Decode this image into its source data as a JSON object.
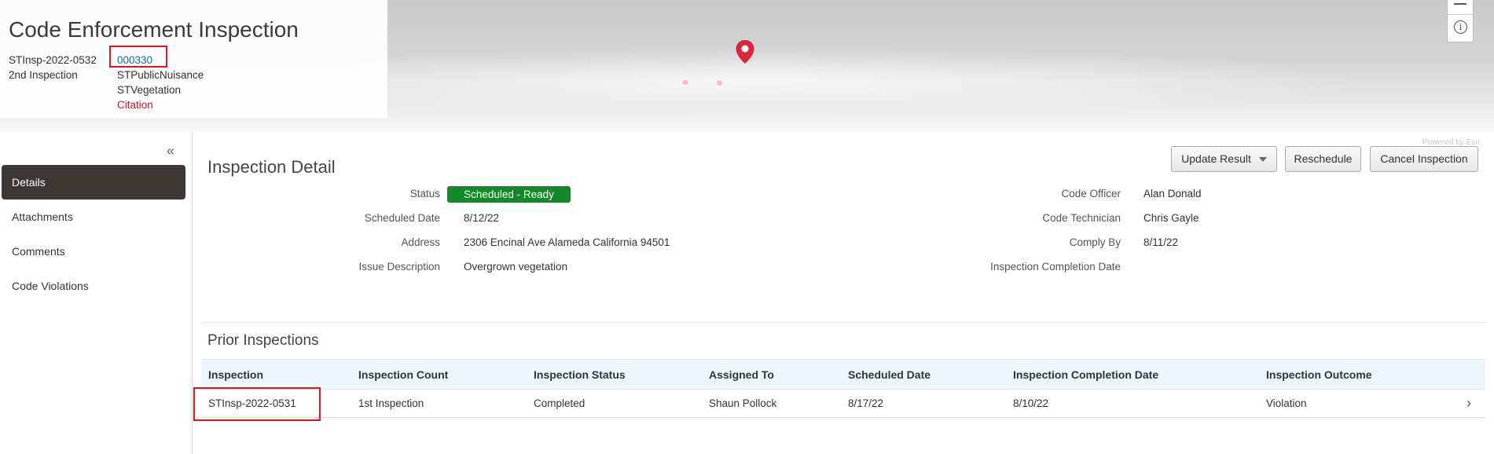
{
  "header": {
    "title": "Code Enforcement Inspection",
    "inspection_id": "STInsp-2022-0532",
    "inspection_count": "2nd Inspection",
    "case_link": "000330",
    "tags": [
      "STPublicNuisance",
      "STVegetation"
    ],
    "citation": "Citation"
  },
  "map": {
    "powered_by": "Powered by Esri",
    "pin_color": "#d8283c",
    "controls": {
      "zoom_out": "—",
      "info": "ⓘ"
    }
  },
  "sidebar": {
    "collapse_icon": "«",
    "items": [
      {
        "label": "Details",
        "active": true
      },
      {
        "label": "Attachments"
      },
      {
        "label": "Comments"
      },
      {
        "label": "Code Violations"
      }
    ]
  },
  "detail": {
    "title": "Inspection Detail",
    "buttons": {
      "update_result": "Update Result",
      "reschedule": "Reschedule",
      "cancel": "Cancel Inspection"
    },
    "status_label": "Status",
    "status_value": "Scheduled - Ready",
    "status_color": "#138a2a",
    "scheduled_date_label": "Scheduled Date",
    "scheduled_date": "8/12/22",
    "address_label": "Address",
    "address": "2306 Encinal Ave Alameda California 94501",
    "issue_label": "Issue Description",
    "issue": "Overgrown vegetation",
    "officer_label": "Code Officer",
    "officer": "Alan Donald",
    "technician_label": "Code Technician",
    "technician": "Chris Gayle",
    "comply_label": "Comply By",
    "comply_by": "8/11/22",
    "completion_label": "Inspection Completion Date",
    "completion_date": ""
  },
  "prior": {
    "title": "Prior Inspections",
    "columns": [
      "Inspection",
      "Inspection Count",
      "Inspection Status",
      "Assigned To",
      "Scheduled Date",
      "Inspection Completion Date",
      "Inspection Outcome"
    ],
    "rows": [
      [
        "STInsp-2022-0531",
        "1st Inspection",
        "Completed",
        "Shaun Pollock",
        "8/17/22",
        "8/10/22",
        "Violation"
      ]
    ]
  }
}
